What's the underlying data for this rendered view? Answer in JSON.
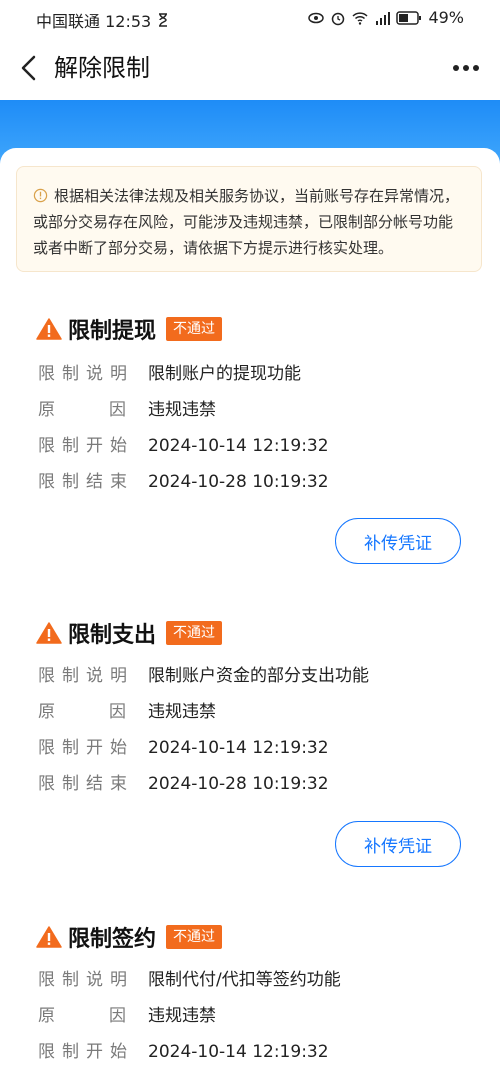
{
  "status_bar": {
    "carrier_time": "中国联通 12:53",
    "battery": "49%"
  },
  "header": {
    "title": "解除限制"
  },
  "notice": {
    "text": "根据相关法律法规及相关服务协议，当前账号存在异常情况，或部分交易存在风险，可能涉及违规违禁，已限制部分帐号功能或者中断了部分交易，请依据下方提示进行核实处理。"
  },
  "restrictions": [
    {
      "title": "限制提现",
      "badge": "不通过",
      "desc_label": "限制说明",
      "desc": "限制账户的提现功能",
      "reason_label": "原因",
      "reason": "违规违禁",
      "start_label": "限制开始",
      "start": "2024-10-14 12:19:32",
      "end_label": "限制结束",
      "end": "2024-10-28 10:19:32",
      "button": "补传凭证"
    },
    {
      "title": "限制支出",
      "badge": "不通过",
      "desc_label": "限制说明",
      "desc": "限制账户资金的部分支出功能",
      "reason_label": "原因",
      "reason": "违规违禁",
      "start_label": "限制开始",
      "start": "2024-10-14 12:19:32",
      "end_label": "限制结束",
      "end": "2024-10-28 10:19:32",
      "button": "补传凭证"
    },
    {
      "title": "限制签约",
      "badge": "不通过",
      "desc_label": "限制说明",
      "desc": "限制代付/代扣等签约功能",
      "reason_label": "原因",
      "reason": "违规违禁",
      "start_label": "限制开始",
      "start": "2024-10-14 12:19:32"
    }
  ],
  "icons": {
    "back": "chevron-left-icon",
    "more": "more-dots-icon",
    "notice": "info-circle-icon",
    "warning": "warning-triangle-icon"
  },
  "colors": {
    "accent": "#1677ff",
    "badge": "#f26b1d",
    "warning": "#f26b1d"
  }
}
